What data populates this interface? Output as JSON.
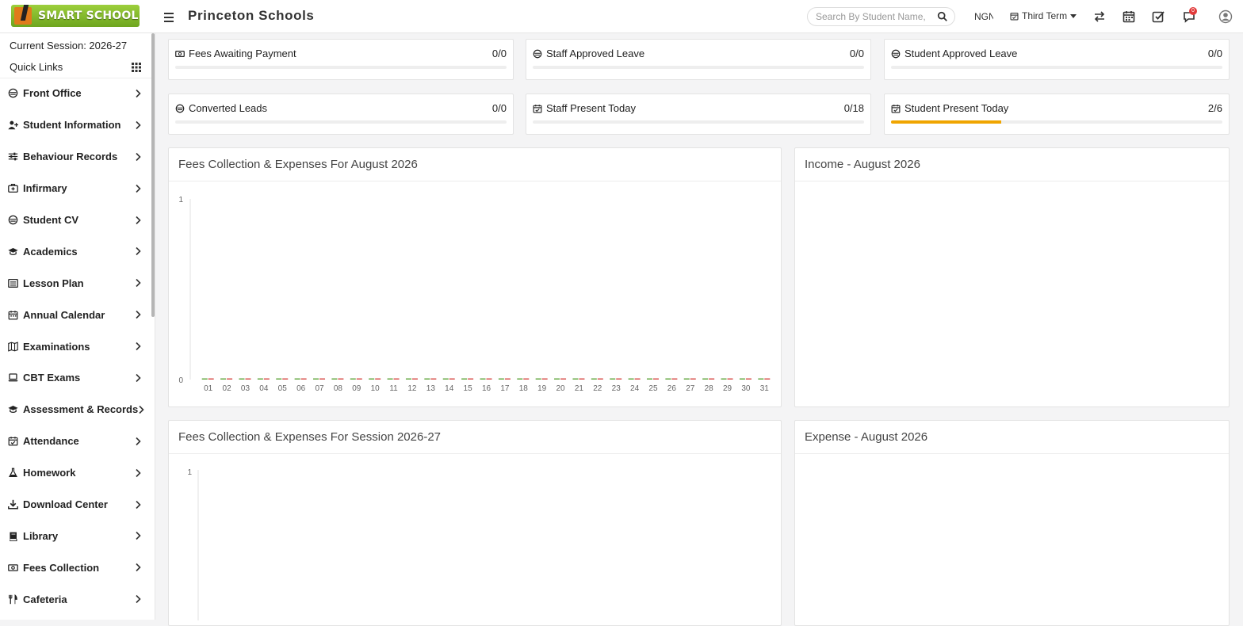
{
  "topbar": {
    "logo_text": "SMART SCHOOL",
    "school_name": "Princeton Schools",
    "search_placeholder": "Search By Student Name,",
    "currency": "NGN",
    "term": "Third Term",
    "chat_badge": "0"
  },
  "sidebar": {
    "session": "Current Session: 2026-27",
    "quick_links": "Quick Links",
    "items": [
      {
        "label": "Front Office",
        "icon": "desk-icon"
      },
      {
        "label": "Student Information",
        "icon": "user-plus-icon"
      },
      {
        "label": "Behaviour Records",
        "icon": "sliders-icon"
      },
      {
        "label": "Infirmary",
        "icon": "briefcase-medical-icon"
      },
      {
        "label": "Student CV",
        "icon": "desk-icon"
      },
      {
        "label": "Academics",
        "icon": "graduation-cap-icon"
      },
      {
        "label": "Lesson Plan",
        "icon": "list-icon"
      },
      {
        "label": "Annual Calendar",
        "icon": "calendar-icon"
      },
      {
        "label": "Examinations",
        "icon": "map-icon"
      },
      {
        "label": "CBT Exams",
        "icon": "laptop-icon"
      },
      {
        "label": "Assessment & Records",
        "icon": "graduation-cap-icon"
      },
      {
        "label": "Attendance",
        "icon": "calendar-check-icon"
      },
      {
        "label": "Homework",
        "icon": "flask-icon"
      },
      {
        "label": "Download Center",
        "icon": "download-icon"
      },
      {
        "label": "Library",
        "icon": "book-icon"
      },
      {
        "label": "Fees Collection",
        "icon": "money-icon"
      },
      {
        "label": "Cafeteria",
        "icon": "utensils-icon"
      }
    ]
  },
  "stats": [
    {
      "title": "Fees Awaiting Payment",
      "value": "0/0",
      "progress": 0,
      "icon": "money-icon"
    },
    {
      "title": "Staff Approved Leave",
      "value": "0/0",
      "progress": 0,
      "icon": "desk-icon"
    },
    {
      "title": "Student Approved Leave",
      "value": "0/0",
      "progress": 0,
      "icon": "desk-icon"
    },
    {
      "title": "Converted Leads",
      "value": "0/0",
      "progress": 0,
      "icon": "desk-icon"
    },
    {
      "title": "Staff Present Today",
      "value": "0/18",
      "progress": 0,
      "icon": "calendar-check-icon"
    },
    {
      "title": "Student Present Today",
      "value": "2/6",
      "progress": 0.333,
      "icon": "calendar-check-icon"
    }
  ],
  "panels": {
    "fees_month_title": "Fees Collection & Expenses For August 2026",
    "income_title": "Income - August 2026",
    "fees_session_title": "Fees Collection & Expenses For Session 2026-27",
    "expense_title": "Expense - August 2026"
  },
  "colors": {
    "accent": "#f0a500",
    "fees_series": "#66aa44",
    "expense_series": "#d9534f"
  },
  "chart_data": [
    {
      "type": "bar",
      "title": "Fees Collection & Expenses For August 2026",
      "categories": [
        "01",
        "02",
        "03",
        "04",
        "05",
        "06",
        "07",
        "08",
        "09",
        "10",
        "11",
        "12",
        "13",
        "14",
        "15",
        "16",
        "17",
        "18",
        "19",
        "20",
        "21",
        "22",
        "23",
        "24",
        "25",
        "26",
        "27",
        "28",
        "29",
        "30",
        "31"
      ],
      "series": [
        {
          "values": [
            0,
            0,
            0,
            0,
            0,
            0,
            0,
            0,
            0,
            0,
            0,
            0,
            0,
            0,
            0,
            0,
            0,
            0,
            0,
            0,
            0,
            0,
            0,
            0,
            0,
            0,
            0,
            0,
            0,
            0,
            0
          ]
        },
        {
          "values": [
            0,
            0,
            0,
            0,
            0,
            0,
            0,
            0,
            0,
            0,
            0,
            0,
            0,
            0,
            0,
            0,
            0,
            0,
            0,
            0,
            0,
            0,
            0,
            0,
            0,
            0,
            0,
            0,
            0,
            0,
            0
          ]
        }
      ],
      "ylim": [
        0,
        1
      ],
      "yticks": [
        "1",
        "0"
      ]
    },
    {
      "type": "bar",
      "title": "Fees Collection & Expenses For Session 2026-27",
      "categories": [],
      "series": [],
      "ylim": [
        0,
        1
      ],
      "yticks": [
        "1"
      ]
    }
  ]
}
